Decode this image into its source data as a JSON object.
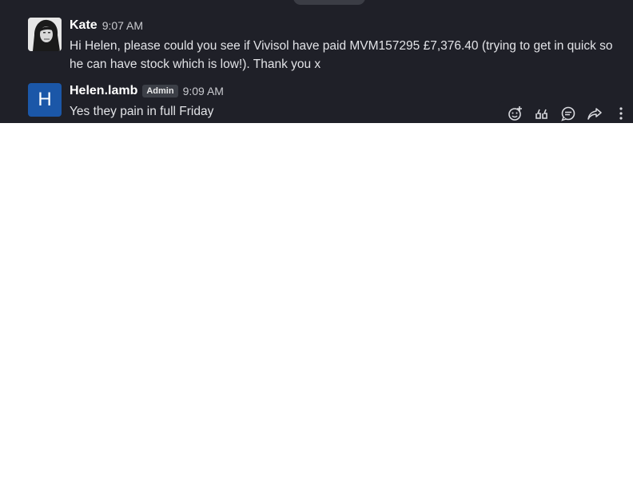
{
  "messages": [
    {
      "author": "Kate",
      "time": "9:07 AM",
      "text": "Hi Helen, please could you see if Vivisol have paid MVM157295 £7,376.40 (trying to get in quick so he can have stock which is low!). Thank you x",
      "avatar": "photo"
    },
    {
      "author": "Helen.lamb",
      "badge": "Admin",
      "time": "9:09 AM",
      "text": "Yes they pain in full Friday",
      "avatar_letter": "H",
      "avatar_color": "#1b57a8"
    }
  ],
  "hover_actions": [
    "add-reaction-icon",
    "quote-icon",
    "reply-thread-icon",
    "share-icon",
    "more-options-icon"
  ],
  "colors": {
    "background": "#1f2028",
    "text": "#e2e3e7",
    "name": "#ffffff",
    "timestamp": "#c9cacf"
  }
}
